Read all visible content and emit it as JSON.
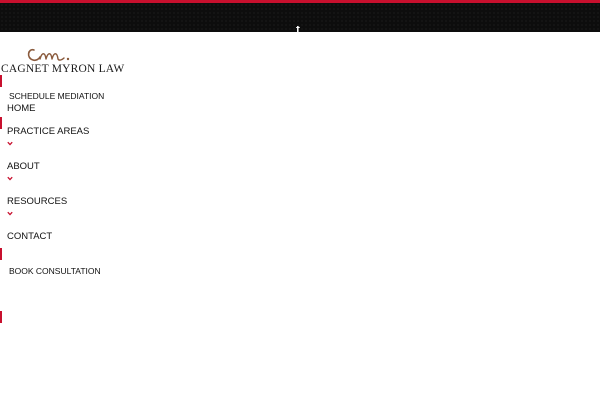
{
  "header": {
    "social_icon": "facebook-icon",
    "social_glyph": "f"
  },
  "logo": {
    "monogram": "CM.",
    "name": "CAGNET MYRON LAW"
  },
  "nav": {
    "schedule_label": "SCHEDULE MEDIATION",
    "items": [
      {
        "label": "HOME",
        "has_dropdown": false
      },
      {
        "label": "PRACTICE AREAS",
        "has_dropdown": true
      },
      {
        "label": "ABOUT",
        "has_dropdown": true
      },
      {
        "label": "RESOURCES",
        "has_dropdown": true
      },
      {
        "label": "CONTACT",
        "has_dropdown": false
      }
    ],
    "book_label": "BOOK CONSULTATION"
  },
  "colors": {
    "accent": "#c8102e",
    "topbar": "#0d0d0d",
    "logo_mark": "#8a5a3c",
    "text": "#111111"
  }
}
